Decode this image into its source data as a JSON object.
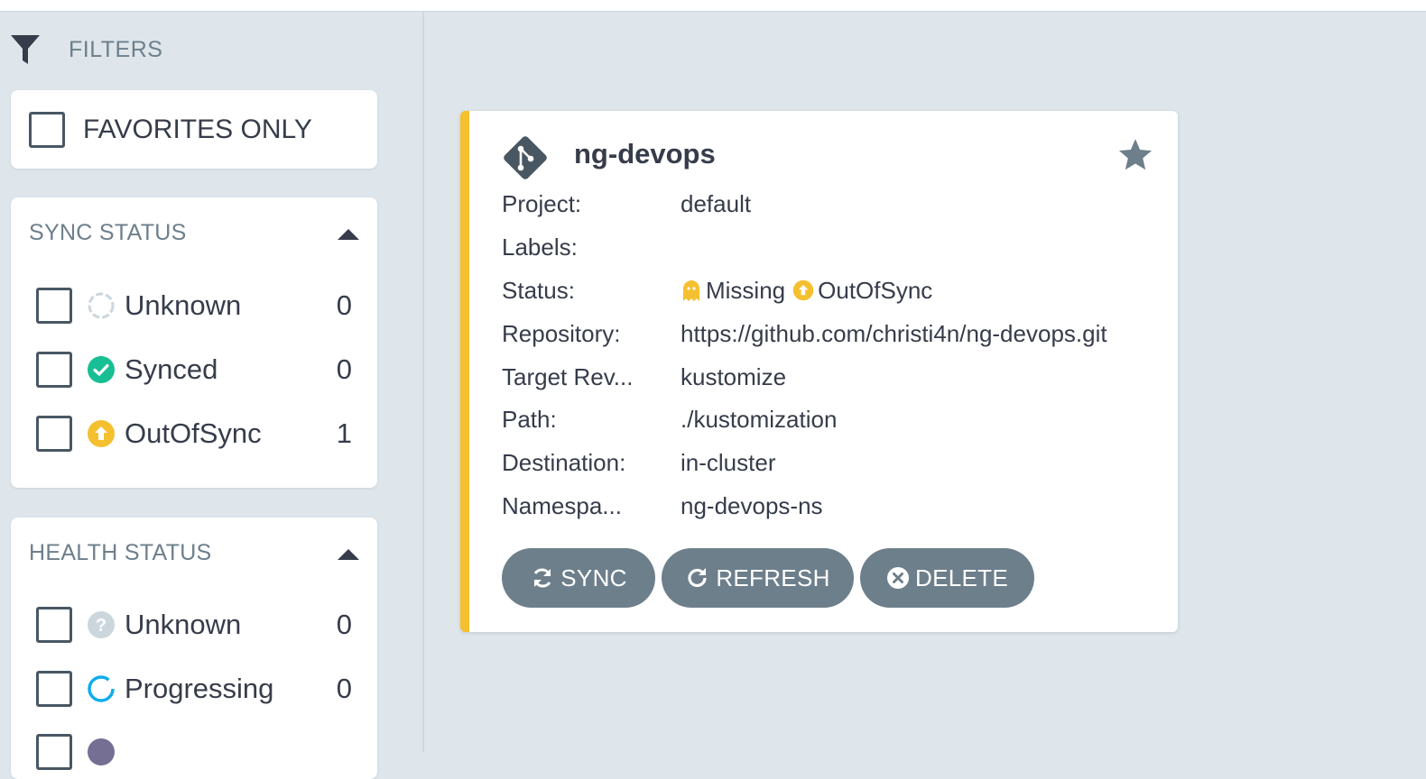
{
  "filters": {
    "title": "FILTERS",
    "favorites_label": "FAVORITES ONLY"
  },
  "sync_status": {
    "title": "SYNC STATUS",
    "items": [
      {
        "label": "Unknown",
        "count": "0",
        "icon": "circle-outline-icon"
      },
      {
        "label": "Synced",
        "count": "0",
        "icon": "check-circle-icon"
      },
      {
        "label": "OutOfSync",
        "count": "1",
        "icon": "arrow-up-circle-icon"
      }
    ]
  },
  "health_status": {
    "title": "HEALTH STATUS",
    "items": [
      {
        "label": "Unknown",
        "count": "0",
        "icon": "question-circle-icon"
      },
      {
        "label": "Progressing",
        "count": "0",
        "icon": "progress-ring-icon"
      }
    ]
  },
  "app": {
    "name": "ng-devops",
    "fields": {
      "project": {
        "key": "Project:",
        "value": "default"
      },
      "labels": {
        "key": "Labels:",
        "value": ""
      },
      "status": {
        "key": "Status:",
        "health": "Missing",
        "sync": "OutOfSync"
      },
      "repository": {
        "key": "Repository:",
        "value": "https://github.com/christi4n/ng-devops.git"
      },
      "target_revision": {
        "key": "Target Rev...",
        "value": "kustomize"
      },
      "path": {
        "key": "Path:",
        "value": "./kustomization"
      },
      "destination": {
        "key": "Destination:",
        "value": "in-cluster"
      },
      "namespace": {
        "key": "Namespa...",
        "value": "ng-devops-ns"
      }
    },
    "actions": {
      "sync": "SYNC",
      "refresh": "REFRESH",
      "delete": "DELETE"
    }
  },
  "colors": {
    "out_of_sync": "#f4c030",
    "synced": "#18be94",
    "progressing": "#0dadea",
    "unknown": "#ccd6dd",
    "button": "#6d7f8b"
  }
}
